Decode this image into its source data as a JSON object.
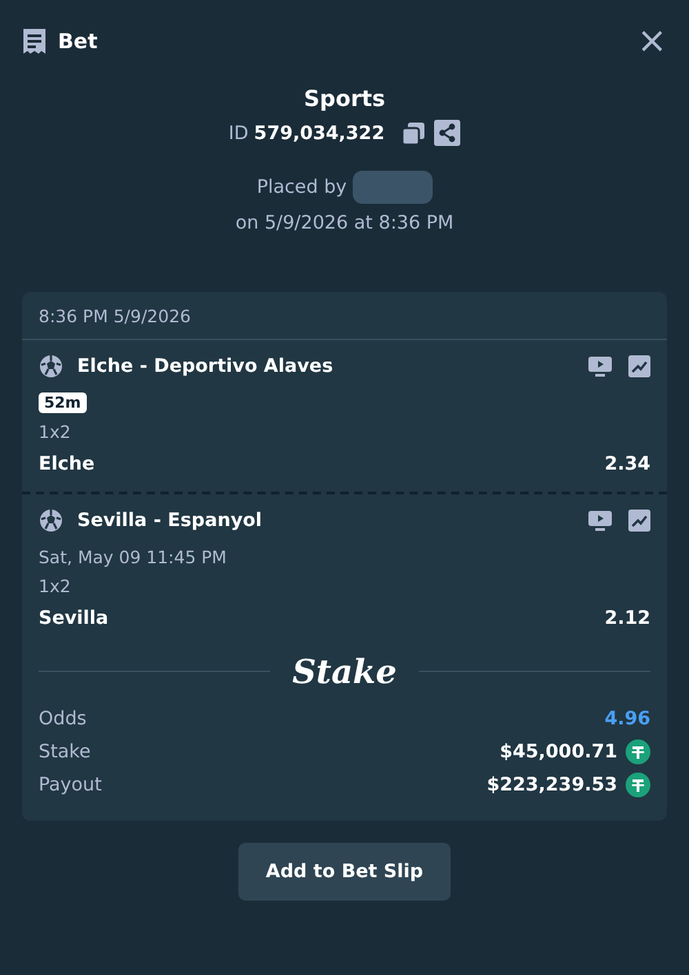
{
  "window": {
    "title": "Bet",
    "close": "×"
  },
  "bet": {
    "category": "Sports",
    "id_label": "ID",
    "id": "579,034,322",
    "placed_by": "Placed by",
    "placed_on": "on 5/9/2026 at 8:36 PM"
  },
  "slip": {
    "timestamp": "8:36 PM 5/9/2026",
    "legs": [
      {
        "match": "Elche - Deportivo Alaves",
        "badge": "52m",
        "market": "1x2",
        "pick": "Elche",
        "odds": "2.34"
      },
      {
        "match": "Sevilla - Espanyol",
        "start": "Sat, May 09  11:45 PM",
        "market": "1x2",
        "pick": "Sevilla",
        "odds": "2.12"
      }
    ],
    "brand": "Stake",
    "summary": [
      {
        "label": "Odds",
        "value": "4.96",
        "kind": "odds"
      },
      {
        "label": "Stake",
        "value": "$45,000.71",
        "kind": "amount"
      },
      {
        "label": "Payout",
        "value": "$223,239.53",
        "kind": "amount"
      }
    ]
  },
  "button": "Add to Bet Slip"
}
